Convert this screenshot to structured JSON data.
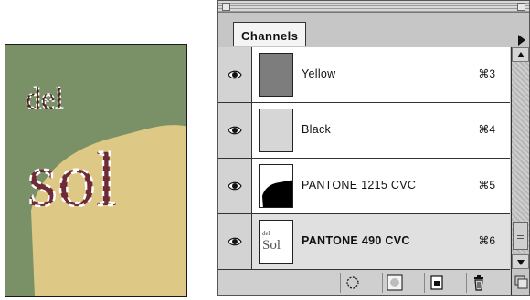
{
  "artwork": {
    "word_small": "del",
    "word_large": "sol",
    "colors": {
      "background": "#7a9167",
      "shape": "#ddc985",
      "letters": "#6e2a36"
    }
  },
  "panel": {
    "tab_label": "Channels",
    "channels": [
      {
        "name": "Yellow",
        "shortcut": "⌘3",
        "visible": true,
        "active": false,
        "thumb": "gray-fill"
      },
      {
        "name": "Black",
        "shortcut": "⌘4",
        "visible": true,
        "active": false,
        "thumb": "light-fill"
      },
      {
        "name": "PANTONE 1215 CVC",
        "shortcut": "⌘5",
        "visible": true,
        "active": false,
        "thumb": "black-blob"
      },
      {
        "name": "PANTONE 490 CVC",
        "shortcut": "⌘6",
        "visible": true,
        "active": true,
        "thumb": "text-preview",
        "thumb_text_small": "del",
        "thumb_text_large": "Sol"
      }
    ],
    "bottom_icons": [
      "load-selection-icon",
      "save-selection-icon",
      "new-channel-icon",
      "trash-icon"
    ]
  }
}
